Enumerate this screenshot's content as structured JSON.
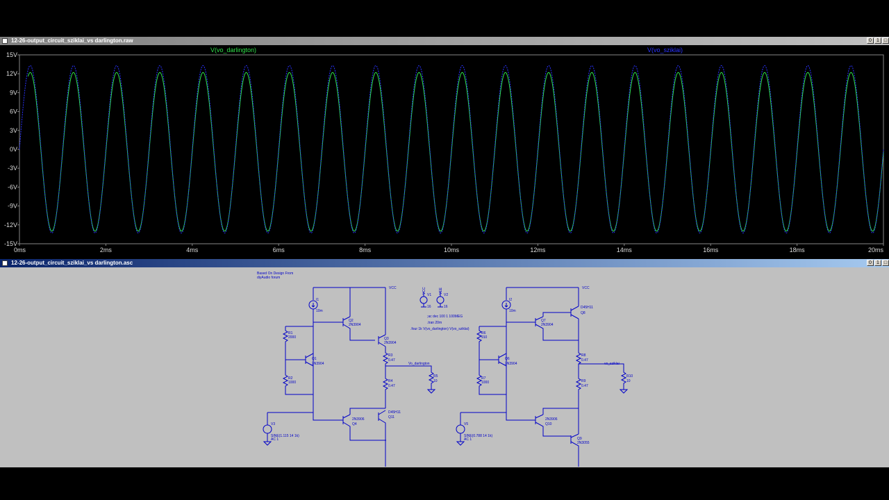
{
  "waveform": {
    "title": "12-26-output_circuit_sziklai_vs darlington.raw",
    "traces": [
      {
        "name": "V(vo_darlington)",
        "color": "#2fe04a"
      },
      {
        "name": "V(vo_sziklai)",
        "color": "#2a33ff"
      }
    ],
    "window_buttons": [
      "0",
      "1",
      "□"
    ]
  },
  "schematic": {
    "title": "12-26-output_circuit_sziklai_vs darlington.asc",
    "window_buttons": [
      "0",
      "1",
      "□"
    ],
    "texts": {
      "note1": "Based On Design From",
      "note2": "diyAudio forum",
      "vcc1": "VCC",
      "vcc2": "VCC",
      "i1": "I1",
      "i1v": "10m",
      "i2": "I2",
      "i2v": "10m",
      "v1": "V1",
      "v1v": "16",
      "v2": "V2",
      "v2v": "16",
      "vccs": "VCC",
      "vees": "VEE",
      "q2": "Q2",
      "q2m": "2N3904",
      "q3": "Q3",
      "q3m": "2N3904",
      "r1": "R1",
      "r1v": "2000",
      "q1": "Q1",
      "q1m": "2N3904",
      "r2": "R2",
      "r2v": "1000",
      "r3": "R3",
      "r3v": "0.47",
      "r4": "R4",
      "r4v": "0.47",
      "vo1": "Vo_darlington",
      "r5": "R5",
      "r5v": "10",
      "v3": "V3",
      "v3s": "SINE(1.115 14 1k)",
      "v3ac": "AC 1",
      "q4m": "2N3906",
      "q4": "Q4",
      "q11m": "D45H11",
      "q11": "Q11",
      "ac": ";ac dec 100 1 100MEG",
      "tran": ".tran 20m",
      "four": ".four 1k V(vo_darlington) V(vo_sziklai)",
      "q7": "Q7",
      "q7m": "2N3904",
      "q8m": "D45H11",
      "q8": "Q8",
      "r6": "R6",
      "r6v": "910",
      "q6": "Q6",
      "q6m": "2N3904",
      "r7": "R7",
      "r7v": "1000",
      "r8": "R8",
      "r8v": "0.47",
      "r9": "R9",
      "r9v": "0.47",
      "vo2": "vo_sziklai",
      "r10": "R10",
      "r10v": "10",
      "v5": "V5",
      "v5s": "SINE(0.788 14 1k)",
      "v5ac": "AC 1",
      "q10m": "2N3906",
      "q10": "Q10",
      "q9": "Q9",
      "q9m": "2N3055"
    }
  },
  "chart_data": {
    "type": "line",
    "title": "",
    "xlabel": "",
    "ylabel": "",
    "x_ticks": [
      "0ms",
      "2ms",
      "4ms",
      "6ms",
      "8ms",
      "10ms",
      "12ms",
      "14ms",
      "16ms",
      "18ms",
      "20ms"
    ],
    "y_ticks": [
      "15V",
      "12V",
      "9V",
      "6V",
      "3V",
      "0V",
      "-3V",
      "-6V",
      "-9V",
      "-12V",
      "-15V"
    ],
    "xlim": [
      0,
      20
    ],
    "ylim": [
      -15,
      15
    ],
    "x_unit": "ms",
    "series": [
      {
        "name": "V(vo_darlington)",
        "color": "#2fe04a",
        "shape": "sine",
        "amplitude": 12.6,
        "offset": -0.4,
        "frequency_khz": 1,
        "start_x": 0.2,
        "end_x": 20
      },
      {
        "name": "V(vo_sziklai)",
        "color": "#2a33ff",
        "shape": "sine",
        "amplitude": 13.3,
        "offset": 0,
        "frequency_khz": 1,
        "start_x": 0,
        "end_x": 20
      }
    ]
  }
}
